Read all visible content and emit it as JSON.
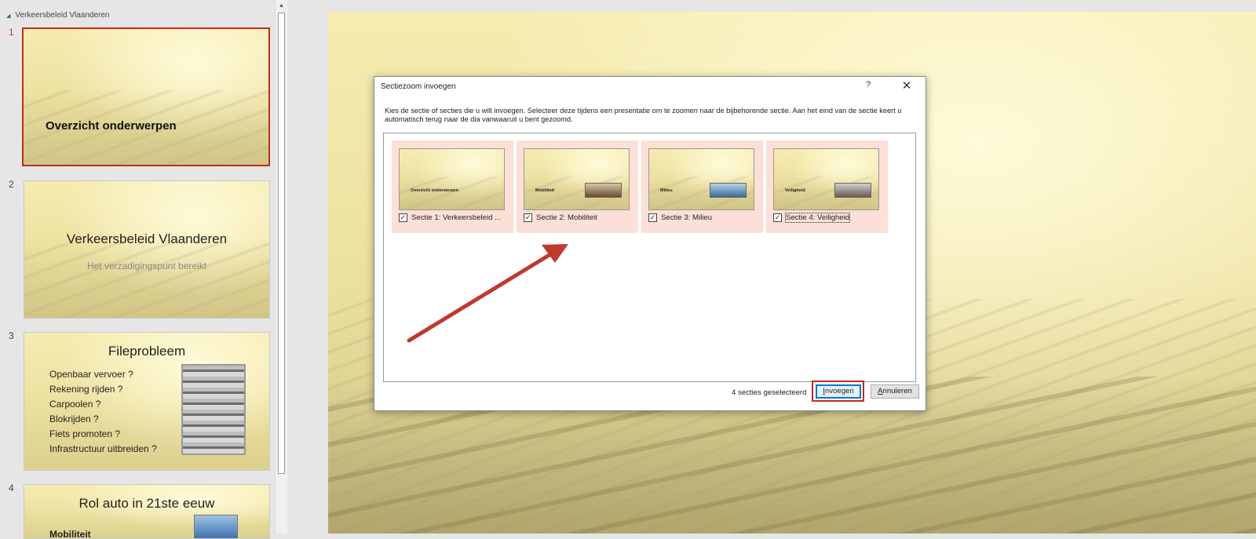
{
  "thumb_pane": {
    "section_name": "Verkeersbeleid Vlaanderen",
    "slides": [
      {
        "number": "1",
        "title": "Overzicht onderwerpen"
      },
      {
        "number": "2",
        "title": "Verkeersbeleid Vlaanderen",
        "subtitle": "Het verzadigingspunt bereikt"
      },
      {
        "number": "3",
        "title": "Fileprobleem",
        "bullets": [
          "Openbaar vervoer ?",
          "Rekening rijden ?",
          "Carpoolen ?",
          "Blokrijden ?",
          "Fiets promoten ?",
          "Infrastructuur uitbreiden ?"
        ]
      },
      {
        "number": "4",
        "title": "Rol auto in 21ste eeuw",
        "text": "Mobiliteit"
      }
    ]
  },
  "dialog": {
    "title": "Sectiezoom invoegen",
    "help_label": "?",
    "close_label": "✕",
    "description": "Kies de sectie of secties die u wilt invoegen. Selecteer deze tijdens een presentatie om te zoomen naar de bijbehorende sectie. Aan het eind van de sectie keert u automatisch terug naar de dia vanwaaruit u bent gezoomd.",
    "sections": [
      {
        "thumb_label": "Overzicht onderwerpen",
        "label": "Sectie 1: Verkeersbeleid ...",
        "checked": true
      },
      {
        "thumb_label": "Mobiliteit",
        "label": "Sectie 2: Mobiliteit",
        "checked": true
      },
      {
        "thumb_label": "Milieu",
        "label": "Sectie 3: Milieu",
        "checked": true
      },
      {
        "thumb_label": "Veiligheid",
        "label": "Sectie 4: Veiligheid",
        "checked": true
      }
    ],
    "check_glyph": "✓",
    "selected_count": "4 secties geselecteerd",
    "insert_button": {
      "mnemonic": "I",
      "rest": "nvoegen"
    },
    "cancel_button": {
      "mnemonic": "A",
      "rest": "nnuleren"
    }
  },
  "colors": {
    "highlight_red": "#c42b1c",
    "section_tile_bg": "#fce0d8",
    "arrow": "#c0392b"
  }
}
